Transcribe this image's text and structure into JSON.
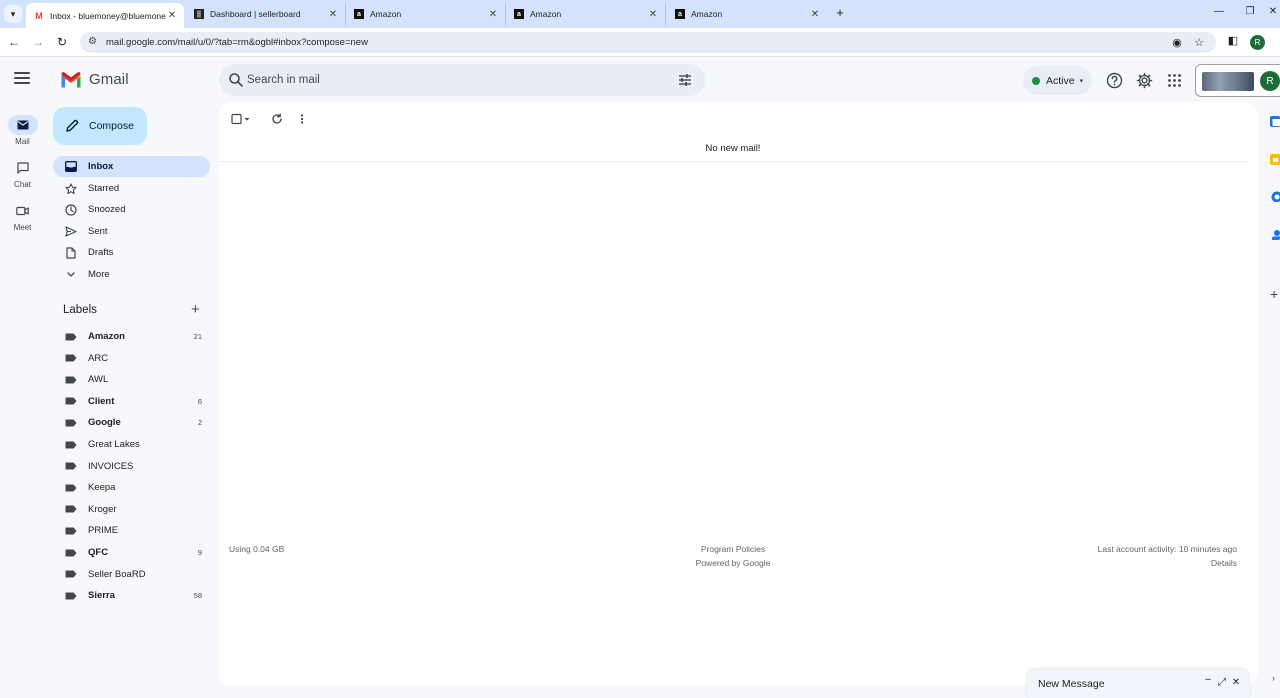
{
  "browser": {
    "tabs": [
      {
        "title": "Inbox - bluemoney@bluemone",
        "favicon": "gmail-favicon",
        "active": true
      },
      {
        "title": "Dashboard | sellerboard",
        "favicon": "sellerboard-favicon",
        "active": false
      },
      {
        "title": "Amazon",
        "favicon": "amazon-favicon",
        "active": false
      },
      {
        "title": "Amazon",
        "favicon": "amazon-favicon",
        "active": false
      },
      {
        "title": "Amazon",
        "favicon": "amazon-favicon",
        "active": false
      }
    ],
    "url": "mail.google.com/mail/u/0/?tab=rm&ogbl#inbox?compose=new",
    "profile_initial": "R"
  },
  "header": {
    "app_name": "Gmail",
    "search_placeholder": "Search in mail",
    "status_label": "Active",
    "avatar_initial": "R"
  },
  "rail": [
    {
      "label": "Mail",
      "icon": "mail-icon"
    },
    {
      "label": "Chat",
      "icon": "chat-icon"
    },
    {
      "label": "Meet",
      "icon": "meet-icon"
    }
  ],
  "compose_label": "Compose",
  "nav": [
    {
      "label": "Inbox",
      "icon": "inbox-icon"
    },
    {
      "label": "Starred",
      "icon": "star-icon"
    },
    {
      "label": "Snoozed",
      "icon": "clock-icon"
    },
    {
      "label": "Sent",
      "icon": "send-icon"
    },
    {
      "label": "Drafts",
      "icon": "draft-icon"
    },
    {
      "label": "More",
      "icon": "chevron-down-icon"
    }
  ],
  "labels_title": "Labels",
  "labels": [
    {
      "name": "Amazon",
      "count": "21"
    },
    {
      "name": "ARC",
      "count": ""
    },
    {
      "name": "AWL",
      "count": ""
    },
    {
      "name": "Client",
      "count": "6"
    },
    {
      "name": "Google",
      "count": "2"
    },
    {
      "name": "Great Lakes",
      "count": ""
    },
    {
      "name": "INVOICES",
      "count": ""
    },
    {
      "name": "Keepa",
      "count": ""
    },
    {
      "name": "Kroger",
      "count": ""
    },
    {
      "name": "PRIME",
      "count": ""
    },
    {
      "name": "QFC",
      "count": "9"
    },
    {
      "name": "Seller BoaRD",
      "count": ""
    },
    {
      "name": "Sierra",
      "count": "58"
    }
  ],
  "main": {
    "empty_message": "No new mail!",
    "storage": "Using 0.04 GB",
    "policies": "Program Policies",
    "powered": "Powered by Google",
    "last_activity": "Last account activity: 10 minutes ago",
    "details": "Details"
  },
  "new_message_title": "New Message",
  "colors": {
    "accent": "#0b57d0",
    "compose_bg": "#c2e7ff",
    "selected_bg": "#d3e3fd",
    "active_status": "#1e8e3e"
  }
}
